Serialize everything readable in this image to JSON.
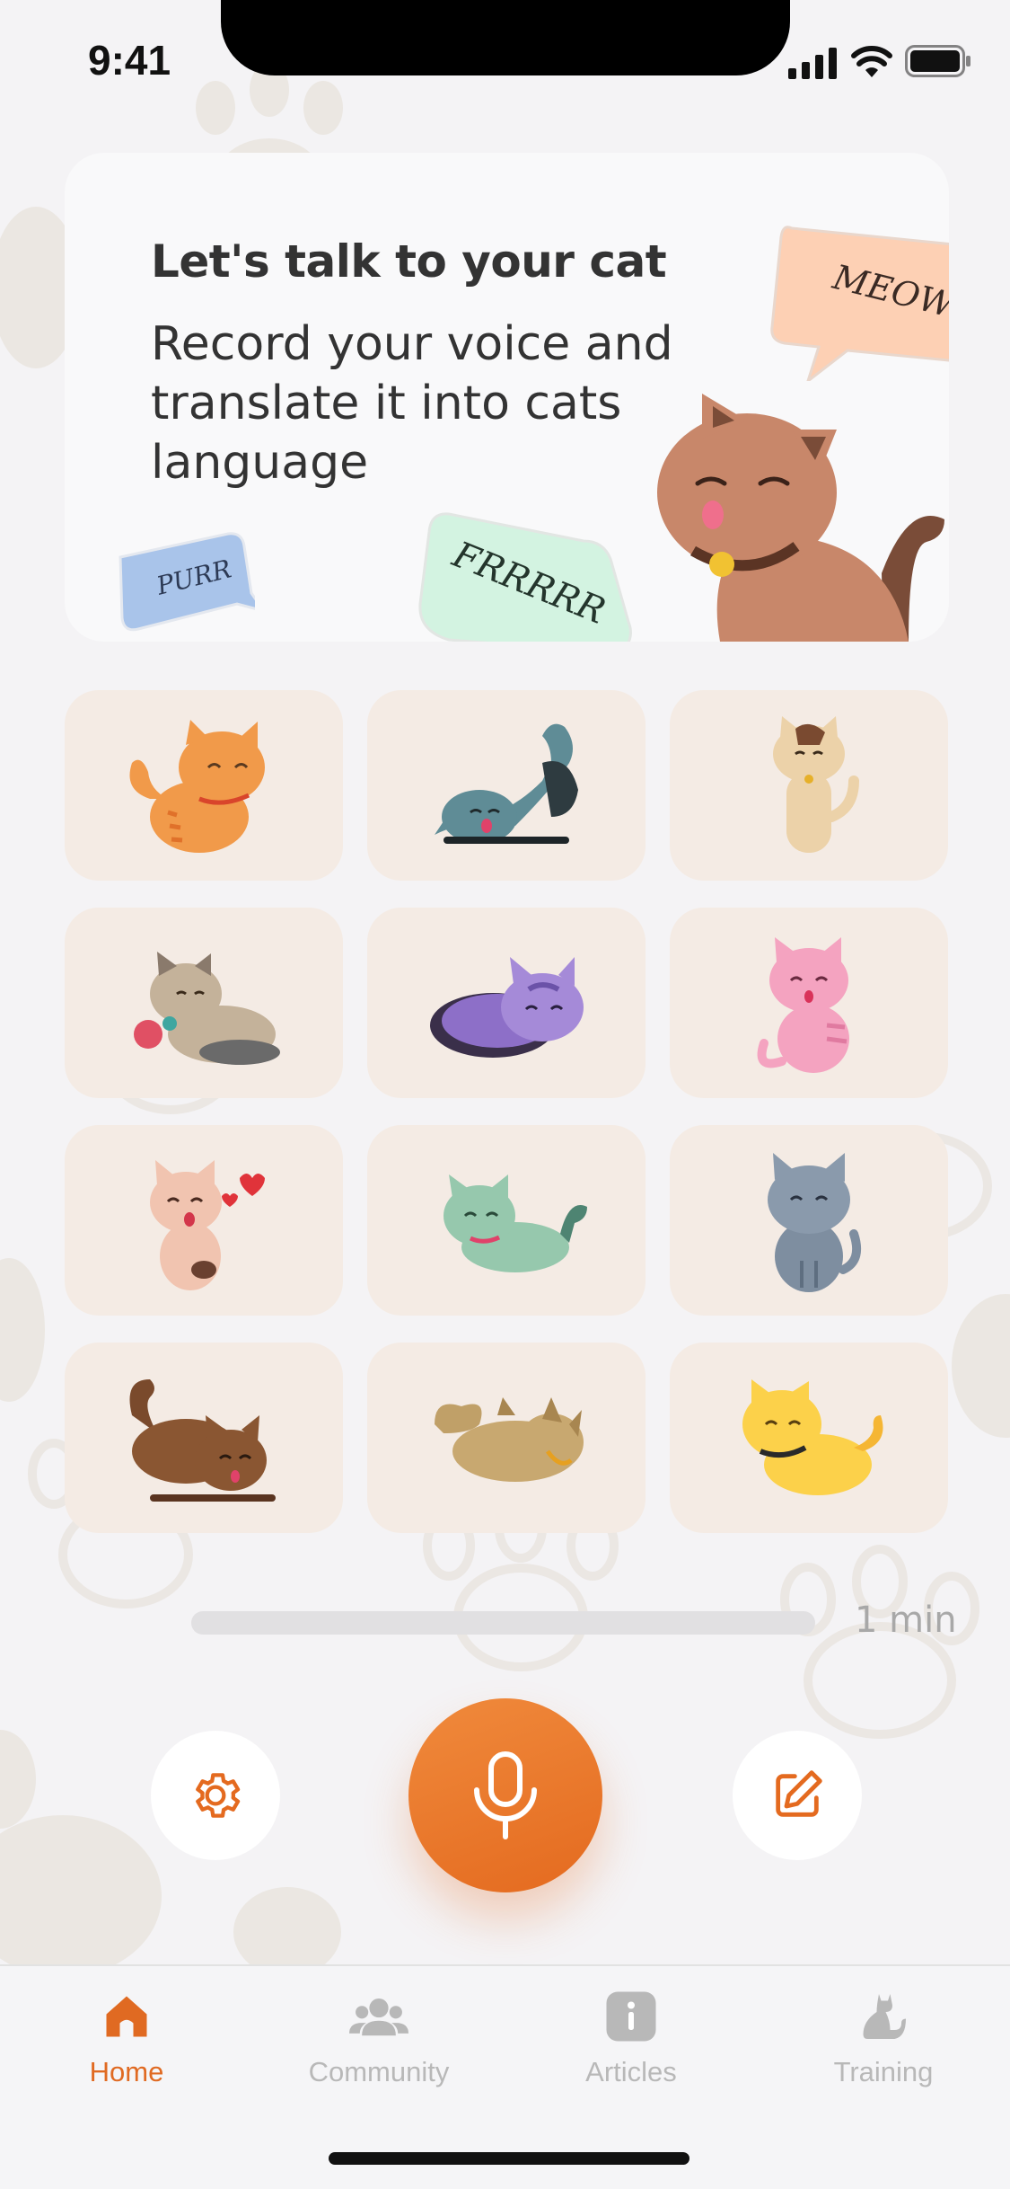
{
  "status_bar": {
    "time": "9:41"
  },
  "hero": {
    "title": "Let's talk to your cat",
    "subtitle": "Record your voice and translate it into cats language",
    "bubbles": {
      "meow": "MEOW",
      "purr": "PURR",
      "frrr": "FRRRRR"
    }
  },
  "cats": [
    {
      "name": "orange-cat"
    },
    {
      "name": "gray-stretching-cat"
    },
    {
      "name": "calico-standing-cat"
    },
    {
      "name": "cat-with-yarn"
    },
    {
      "name": "purple-sleeping-cat"
    },
    {
      "name": "pink-cat"
    },
    {
      "name": "cat-with-hearts"
    },
    {
      "name": "mint-running-cat"
    },
    {
      "name": "blue-gray-cat"
    },
    {
      "name": "brown-stretching-cat"
    },
    {
      "name": "tan-rolling-cat"
    },
    {
      "name": "yellow-cat"
    }
  ],
  "recording": {
    "duration_label": "1 min",
    "progress": 0
  },
  "controls": {
    "settings_icon": "gear-icon",
    "mic_icon": "microphone-icon",
    "edit_icon": "edit-icon"
  },
  "tabs": [
    {
      "label": "Home",
      "icon": "home-icon",
      "active": true
    },
    {
      "label": "Community",
      "icon": "community-icon",
      "active": false
    },
    {
      "label": "Articles",
      "icon": "info-icon",
      "active": false
    },
    {
      "label": "Training",
      "icon": "cat-icon",
      "active": false
    }
  ],
  "colors": {
    "accent": "#E8722C",
    "tile": "#F4EBE4",
    "background": "#F4F3F5"
  }
}
